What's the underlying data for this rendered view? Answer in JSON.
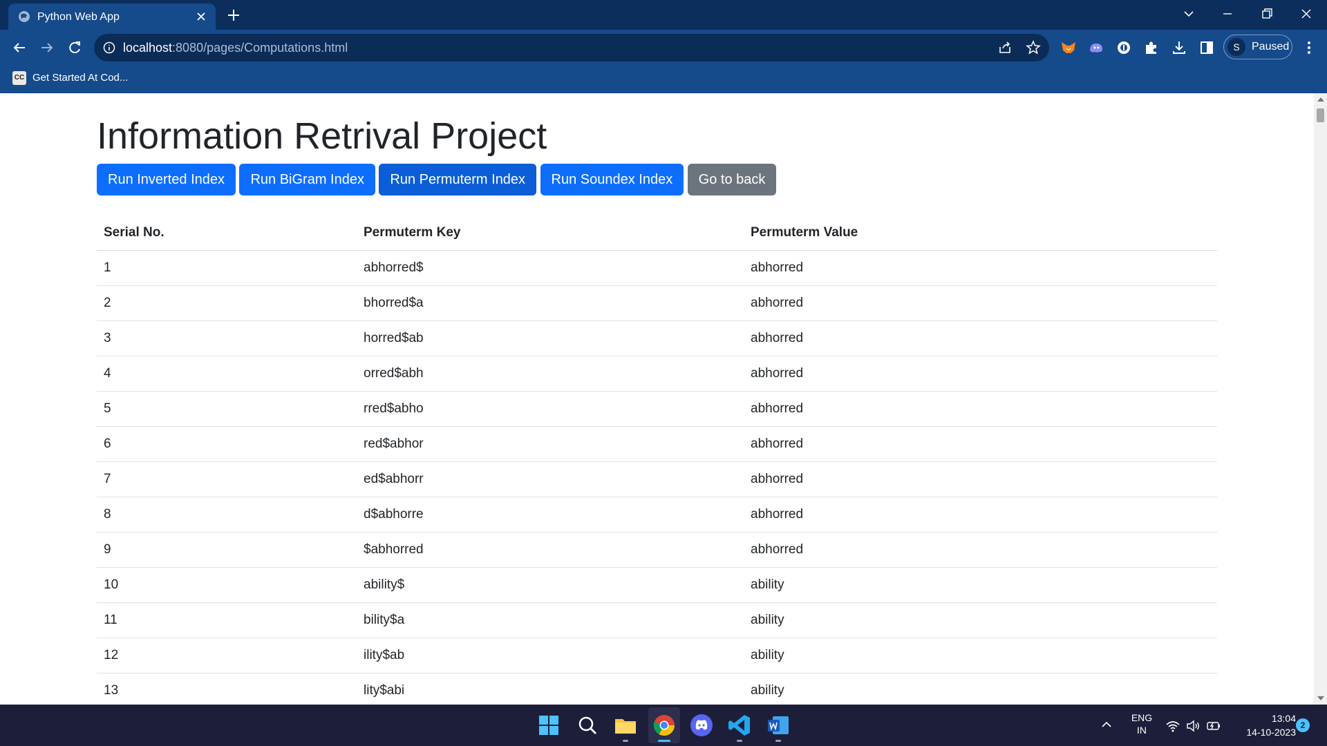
{
  "browser": {
    "tab_title": "Python Web App",
    "url_host": "localhost",
    "url_rest": ":8080/pages/Computations.html",
    "profile_initial": "S",
    "profile_status": "Paused",
    "bookmarks": [
      {
        "icon_text": "CC",
        "label": "Get Started At Cod..."
      }
    ]
  },
  "page": {
    "title": "Information Retrival Project",
    "buttons": [
      {
        "label": "Run Inverted Index",
        "style": "primary"
      },
      {
        "label": "Run BiGram Index",
        "style": "primary"
      },
      {
        "label": "Run Permuterm Index",
        "style": "primary-active"
      },
      {
        "label": "Run Soundex Index",
        "style": "primary"
      },
      {
        "label": "Go to back",
        "style": "secondary"
      }
    ],
    "table": {
      "headers": [
        "Serial No.",
        "Permuterm Key",
        "Permuterm Value"
      ],
      "rows": [
        [
          "1",
          "abhorred$",
          "abhorred"
        ],
        [
          "2",
          "bhorred$a",
          "abhorred"
        ],
        [
          "3",
          "horred$ab",
          "abhorred"
        ],
        [
          "4",
          "orred$abh",
          "abhorred"
        ],
        [
          "5",
          "rred$abho",
          "abhorred"
        ],
        [
          "6",
          "red$abhor",
          "abhorred"
        ],
        [
          "7",
          "ed$abhorr",
          "abhorred"
        ],
        [
          "8",
          "d$abhorre",
          "abhorred"
        ],
        [
          "9",
          "$abhorred",
          "abhorred"
        ],
        [
          "10",
          "ability$",
          "ability"
        ],
        [
          "11",
          "bility$a",
          "ability"
        ],
        [
          "12",
          "ility$ab",
          "ability"
        ],
        [
          "13",
          "lity$abi",
          "ability"
        ]
      ]
    }
  },
  "taskbar": {
    "apps": [
      "start-icon",
      "search-icon",
      "file-explorer-icon",
      "chrome-icon",
      "discord-icon",
      "vscode-icon",
      "word-icon"
    ],
    "lang_line1": "ENG",
    "lang_line2": "IN",
    "time": "13:04",
    "date": "14-10-2023",
    "notification_count": "2"
  },
  "colors": {
    "primary": "#0d6efd",
    "primary_active": "#0b5ed7",
    "secondary": "#6c757d",
    "browser_frame": "#0c2e5c",
    "browser_toolbar": "#154a8b",
    "taskbar": "#1d1f3a"
  }
}
